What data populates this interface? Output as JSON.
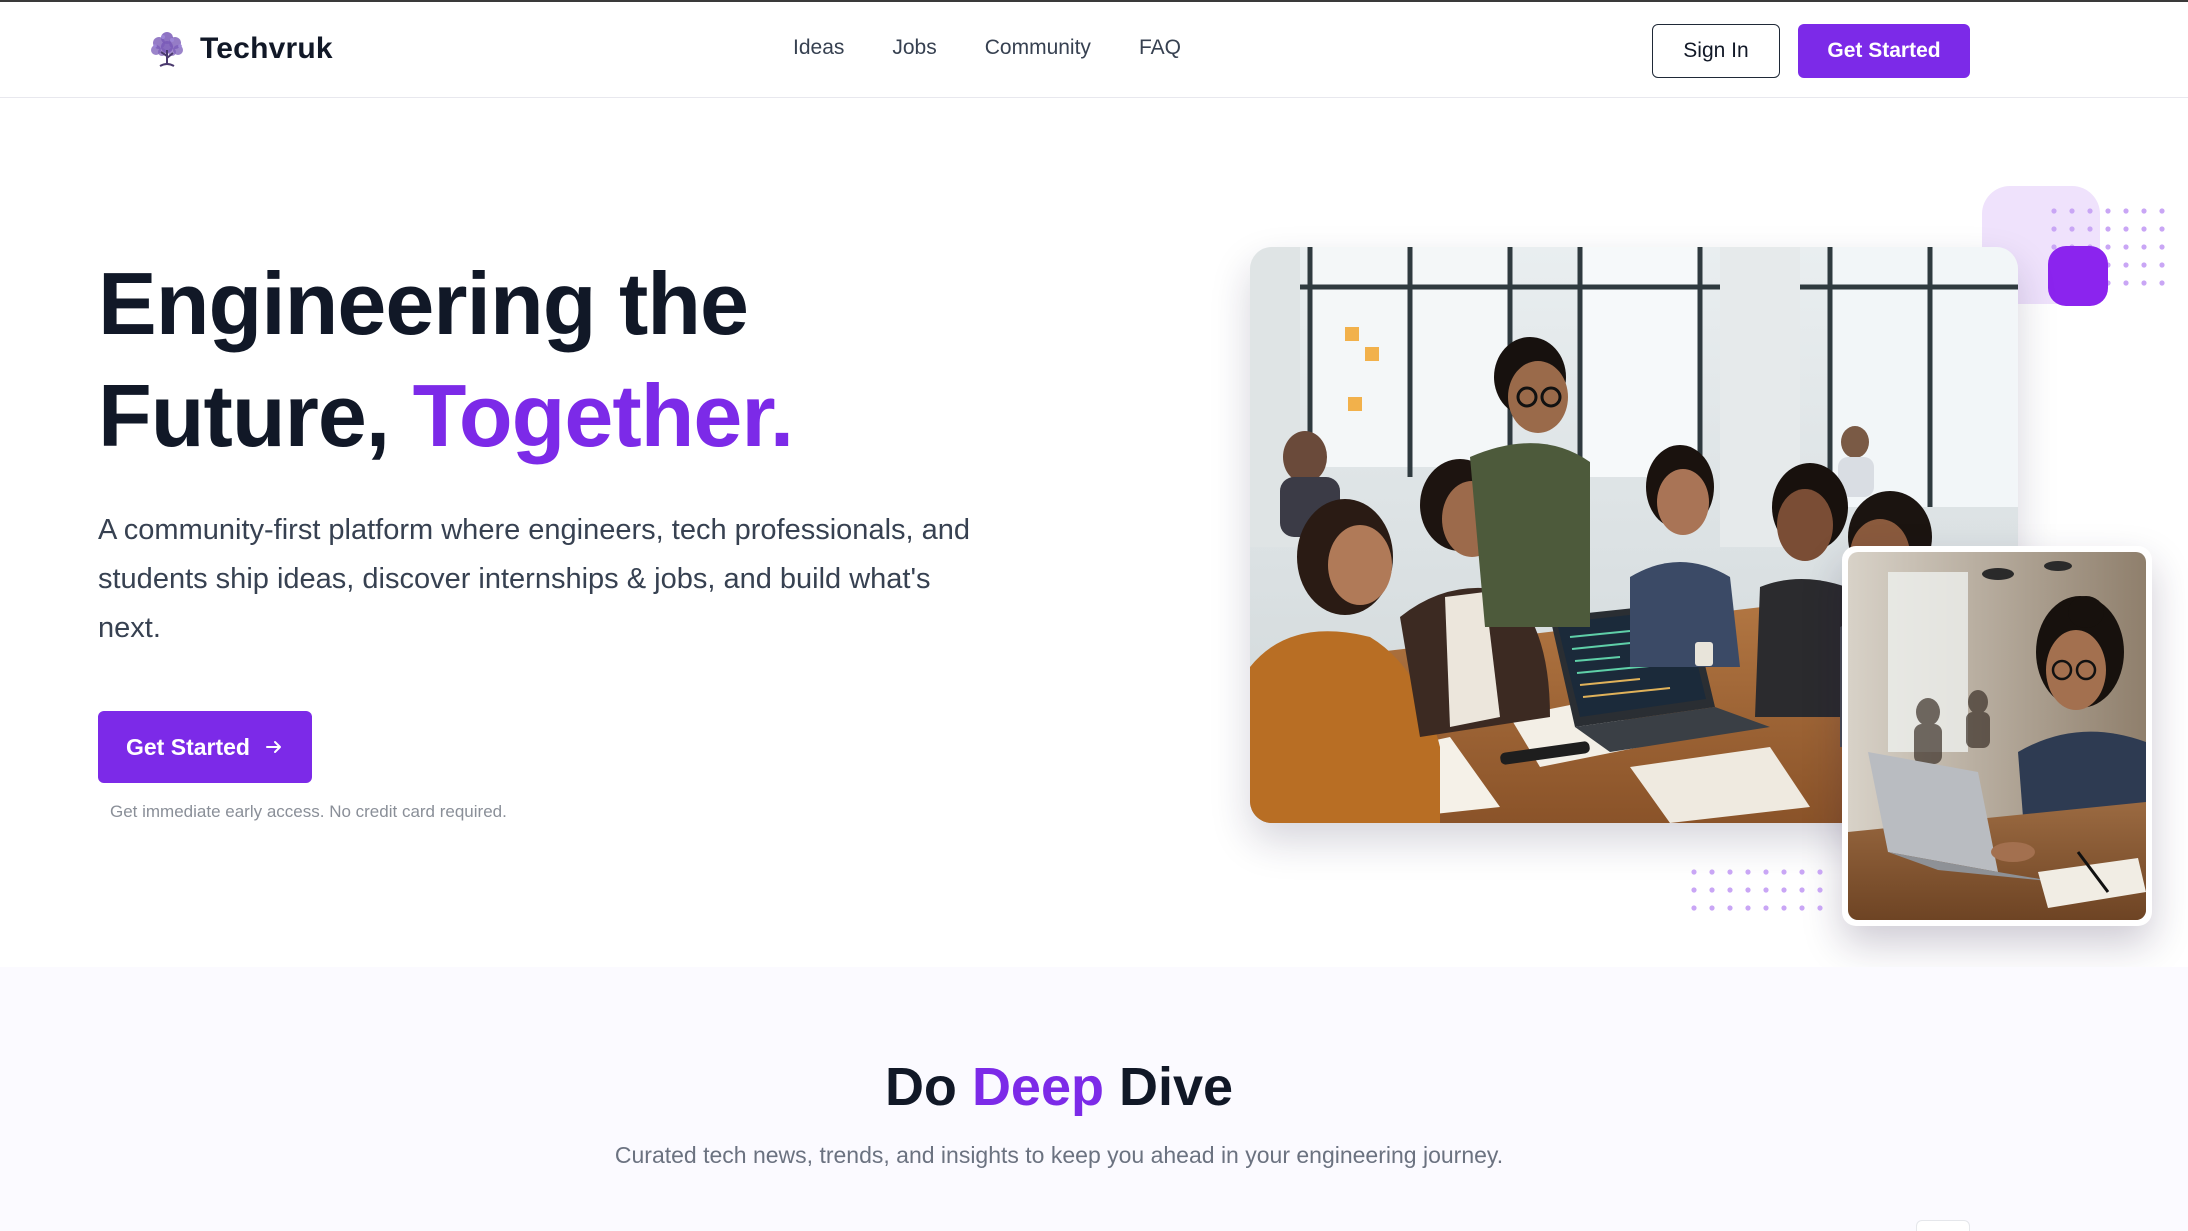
{
  "nav": {
    "brand": "Techvruk",
    "links": [
      "Ideas",
      "Jobs",
      "Community",
      "FAQ"
    ],
    "sign_in": "Sign In",
    "get_started": "Get Started"
  },
  "hero": {
    "title_line1": "Engineering the",
    "title_line2_plain": "Future, ",
    "title_line2_accent": "Together.",
    "subtitle": "A community-first platform where engineers, tech professionals, and students ship ideas, discover internships & jobs, and build what's next.",
    "cta": "Get Started",
    "note": "Get immediate early access. No credit card required."
  },
  "section": {
    "title_plain1": "Do ",
    "title_accent": "Deep",
    "title_plain2": " Dive",
    "subtitle": "Curated tech news, trends, and insights to keep you ahead in your engineering journey."
  },
  "colors": {
    "accent": "#7c2ae8",
    "text": "#111827",
    "muted": "#6b7280"
  },
  "icons": {
    "logo": "tree-logo-icon",
    "cta_arrow": "arrow-right-icon"
  }
}
